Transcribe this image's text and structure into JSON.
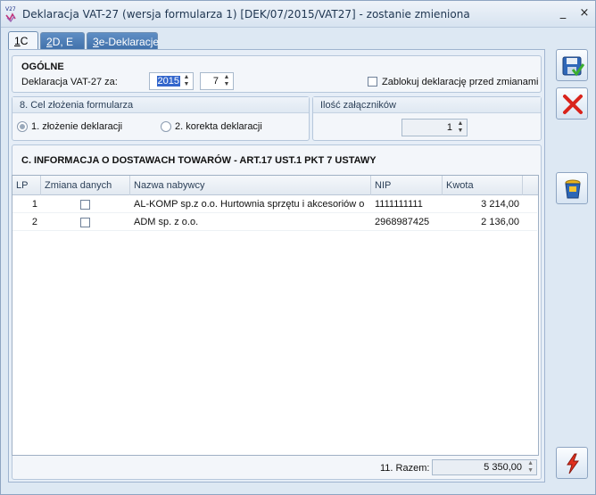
{
  "window": {
    "title": "Deklaracja VAT-27 (wersja formularza 1) [DEK/07/2015/VAT27] - zostanie zmieniona",
    "app_icon": "vat27-app-icon",
    "minimize": "_",
    "close": "×"
  },
  "tabs": [
    {
      "key": "1",
      "label": "C"
    },
    {
      "key": "2",
      "label": "D, E"
    },
    {
      "key": "3",
      "label": "e-Deklaracje"
    }
  ],
  "general": {
    "heading": "OGÓLNE",
    "period_label": "Deklaracja VAT-27 za:",
    "year": "2015",
    "month": "7",
    "lock_label": "Zablokuj deklarację przed zmianami"
  },
  "purpose": {
    "heading": "8. Cel złożenia formularza",
    "option1": "1. złożenie deklaracji",
    "option2": "2. korekta deklaracji"
  },
  "attachments": {
    "heading": "Ilość załączników",
    "value": "1"
  },
  "section_c": {
    "heading": "C. INFORMACJA O DOSTAWACH TOWARÓW - ART.17 UST.1 PKT 7 USTAWY",
    "columns": [
      "LP",
      "Zmiana danych",
      "Nazwa nabywcy",
      "NIP",
      "Kwota"
    ],
    "rows": [
      {
        "lp": "1",
        "name": "AL-KOMP sp.z o.o. Hurtownia sprzętu i akcesoriów o",
        "nip": "1111111111",
        "amount": "3 214,00"
      },
      {
        "lp": "2",
        "name": "ADM sp. z o.o.",
        "nip": "2968987425",
        "amount": "2 136,00"
      }
    ],
    "sum_label": "11. Razem:",
    "sum_value": "5 350,00"
  },
  "side_buttons": [
    "save-icon",
    "cancel-icon",
    "trash-bin-icon",
    "lightning-icon"
  ],
  "colors": {
    "tab_active_bg": "#f2f6fb",
    "tab_inactive_bg": "#3e6ea8",
    "cancel_red": "#d9231b"
  }
}
